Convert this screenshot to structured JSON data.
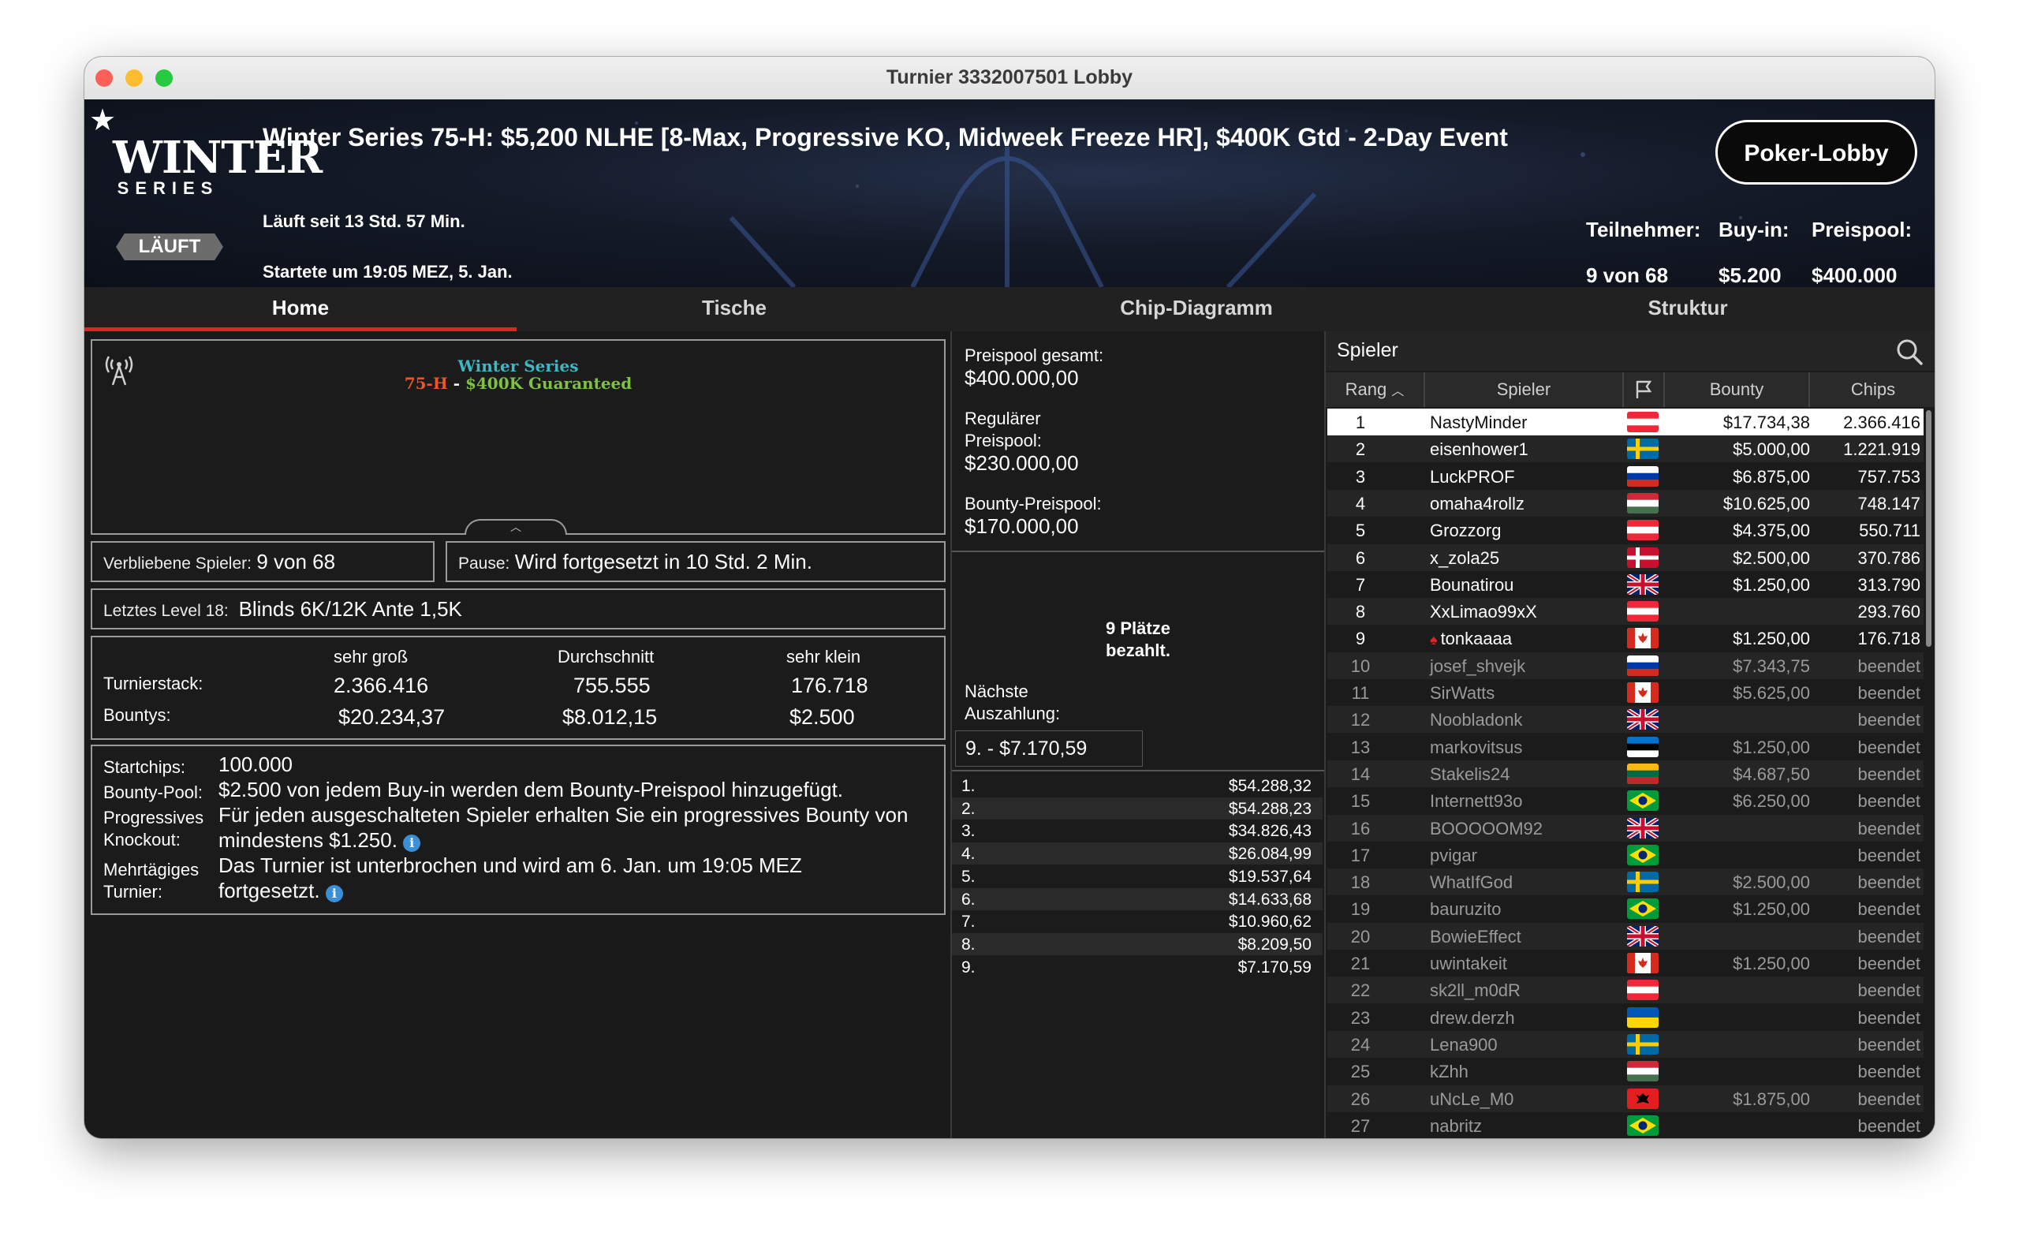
{
  "window": {
    "title": "Turnier 3332007501 Lobby"
  },
  "header": {
    "logo_word1": "WINTER",
    "logo_word2": "SERIES",
    "status": "LÄUFT",
    "event_title": "Winter Series 75-H: $5,200 NLHE [8-Max, Progressive KO, Midweek Freeze HR], $400K Gtd - 2-Day Event",
    "running": "Läuft seit 13 Std. 57 Min.",
    "started": "Startete um 19:05 MEZ, 5. Jan.",
    "lobby_button": "Poker-Lobby",
    "stats": [
      {
        "label": "Teilnehmer:",
        "value": "9 von 68"
      },
      {
        "label": "Buy-in:",
        "value": "$5.200"
      },
      {
        "label": "Preispool:",
        "value": "$400.000"
      }
    ]
  },
  "tabs": [
    "Home",
    "Tische",
    "Chip-Diagramm",
    "Struktur"
  ],
  "announcement": {
    "line1": "Winter Series",
    "code": "75-H",
    "sep": " - ",
    "gtd": "$400K Guaranteed",
    "broadcast_icon": "broadcast-tower-icon",
    "notch_icon": "chevron-up-icon"
  },
  "remaining": {
    "label": "Verbliebene Spieler:",
    "value": "9 von 68"
  },
  "pause": {
    "label": "Pause:",
    "value": "Wird fortgesetzt in 10 Std. 2 Min."
  },
  "last_level": {
    "label": "Letztes Level 18:",
    "value": "Blinds 6K/12K Ante 1,5K"
  },
  "stacks": {
    "headers": [
      "sehr groß",
      "Durchschnitt",
      "sehr klein"
    ],
    "rows": [
      {
        "label": "Turnierstack:",
        "values": [
          "2.366.416",
          "755.555",
          "176.718"
        ]
      },
      {
        "label": "Bountys:",
        "values": [
          "$20.234,37",
          "$8.012,15",
          "$2.500"
        ]
      }
    ]
  },
  "info": [
    {
      "label": "Startchips:",
      "text": "100.000"
    },
    {
      "label": "Bounty-Pool:",
      "text": "$2.500 von jedem Buy-in werden dem Bounty-Preispool hinzugefügt."
    },
    {
      "label1": "Progressives",
      "label2": "Knockout:",
      "text1": "Für jeden ausgeschalteten Spieler erhalten Sie ein progressives Bounty von",
      "text2": "mindestens $1.250."
    },
    {
      "label1": "Mehrtägiges",
      "label2": "Turnier:",
      "text1": "Das Turnier ist unterbrochen und wird am 6. Jan. um 19:05 MEZ",
      "text2": "fortgesetzt."
    }
  ],
  "prizes": {
    "total_label": "Preispool gesamt:",
    "total": "$400.000,00",
    "regular_label1": "Regulärer",
    "regular_label2": "Preispool:",
    "regular": "$230.000,00",
    "bounty_label": "Bounty-Preispool:",
    "bounty": "$170.000,00",
    "paid1": "9 Plätze",
    "paid2": "bezahlt.",
    "next_label1": "Nächste",
    "next_label2": "Auszahlung:",
    "next_value": "9. - $7.170,59",
    "payouts": [
      {
        "place": "1.",
        "amount": "$54.288,32"
      },
      {
        "place": "2.",
        "amount": "$54.288,23"
      },
      {
        "place": "3.",
        "amount": "$34.826,43"
      },
      {
        "place": "4.",
        "amount": "$26.084,99"
      },
      {
        "place": "5.",
        "amount": "$19.537,64"
      },
      {
        "place": "6.",
        "amount": "$14.633,68"
      },
      {
        "place": "7.",
        "amount": "$10.960,62"
      },
      {
        "place": "8.",
        "amount": "$8.209,50"
      },
      {
        "place": "9.",
        "amount": "$7.170,59"
      }
    ]
  },
  "players": {
    "title": "Spieler",
    "columns": [
      "Rang",
      "Spieler",
      "",
      "Bounty",
      "Chips"
    ],
    "rows": [
      {
        "rank": "1",
        "name": "NastyMinder",
        "flag": "at",
        "bounty": "$17.734,38",
        "chips": "2.366.416",
        "active": true,
        "selected": true
      },
      {
        "rank": "2",
        "name": "eisenhower1",
        "flag": "se",
        "bounty": "$5.000,00",
        "chips": "1.221.919",
        "active": true
      },
      {
        "rank": "3",
        "name": "LuckPROF",
        "flag": "ru",
        "bounty": "$6.875,00",
        "chips": "757.753",
        "active": true
      },
      {
        "rank": "4",
        "name": "omaha4rollz",
        "flag": "hu",
        "bounty": "$10.625,00",
        "chips": "748.147",
        "active": true
      },
      {
        "rank": "5",
        "name": "Grozzorg",
        "flag": "at",
        "bounty": "$4.375,00",
        "chips": "550.711",
        "active": true
      },
      {
        "rank": "6",
        "name": "x_zola25",
        "flag": "dk",
        "bounty": "$2.500,00",
        "chips": "370.786",
        "active": true
      },
      {
        "rank": "7",
        "name": "Bounatirou",
        "flag": "gb",
        "bounty": "$1.250,00",
        "chips": "313.790",
        "active": true
      },
      {
        "rank": "8",
        "name": "XxLimao99xX",
        "flag": "at",
        "bounty": "",
        "chips": "293.760",
        "active": true
      },
      {
        "rank": "9",
        "name": "tonkaaaa",
        "flag": "ca",
        "bounty": "$1.250,00",
        "chips": "176.718",
        "active": true,
        "badge": true
      },
      {
        "rank": "10",
        "name": "josef_shvejk",
        "flag": "ru",
        "bounty": "$7.343,75",
        "chips": "beendet"
      },
      {
        "rank": "11",
        "name": "SirWatts",
        "flag": "ca",
        "bounty": "$5.625,00",
        "chips": "beendet"
      },
      {
        "rank": "12",
        "name": "Noobladonk",
        "flag": "gb",
        "bounty": "",
        "chips": "beendet"
      },
      {
        "rank": "13",
        "name": "markovitsus",
        "flag": "ee",
        "bounty": "$1.250,00",
        "chips": "beendet"
      },
      {
        "rank": "14",
        "name": "Stakelis24",
        "flag": "lt",
        "bounty": "$4.687,50",
        "chips": "beendet"
      },
      {
        "rank": "15",
        "name": "Internett93o",
        "flag": "br",
        "bounty": "$6.250,00",
        "chips": "beendet"
      },
      {
        "rank": "16",
        "name": "BOOOOOM92",
        "flag": "gb",
        "bounty": "",
        "chips": "beendet"
      },
      {
        "rank": "17",
        "name": "pvigar",
        "flag": "br",
        "bounty": "",
        "chips": "beendet"
      },
      {
        "rank": "18",
        "name": "WhatIfGod",
        "flag": "se",
        "bounty": "$2.500,00",
        "chips": "beendet"
      },
      {
        "rank": "19",
        "name": "bauruzito",
        "flag": "br",
        "bounty": "$1.250,00",
        "chips": "beendet"
      },
      {
        "rank": "20",
        "name": "BowieEffect",
        "flag": "gb",
        "bounty": "",
        "chips": "beendet"
      },
      {
        "rank": "21",
        "name": "uwintakeit",
        "flag": "ca",
        "bounty": "$1.250,00",
        "chips": "beendet"
      },
      {
        "rank": "22",
        "name": "sk2ll_m0dR",
        "flag": "at",
        "bounty": "",
        "chips": "beendet"
      },
      {
        "rank": "23",
        "name": "drew.derzh",
        "flag": "ua",
        "bounty": "",
        "chips": "beendet"
      },
      {
        "rank": "24",
        "name": "Lena900",
        "flag": "se",
        "bounty": "",
        "chips": "beendet"
      },
      {
        "rank": "25",
        "name": "kZhh",
        "flag": "hu",
        "bounty": "",
        "chips": "beendet"
      },
      {
        "rank": "26",
        "name": "uNcLe_M0",
        "flag": "al",
        "bounty": "$1.875,00",
        "chips": "beendet"
      },
      {
        "rank": "27",
        "name": "nabritz",
        "flag": "br",
        "bounty": "",
        "chips": "beendet"
      }
    ]
  },
  "colors": {
    "accent": "#e02424",
    "link": "#3fb7c2",
    "code": "#e8562a",
    "gtd": "#7ec243",
    "info_icon": "#3a8fd6"
  },
  "icons": {
    "search": "search-icon",
    "flag_header": "flag-icon",
    "sort": "sort-up-icon",
    "favorite": "star-icon",
    "info": "info-icon"
  }
}
